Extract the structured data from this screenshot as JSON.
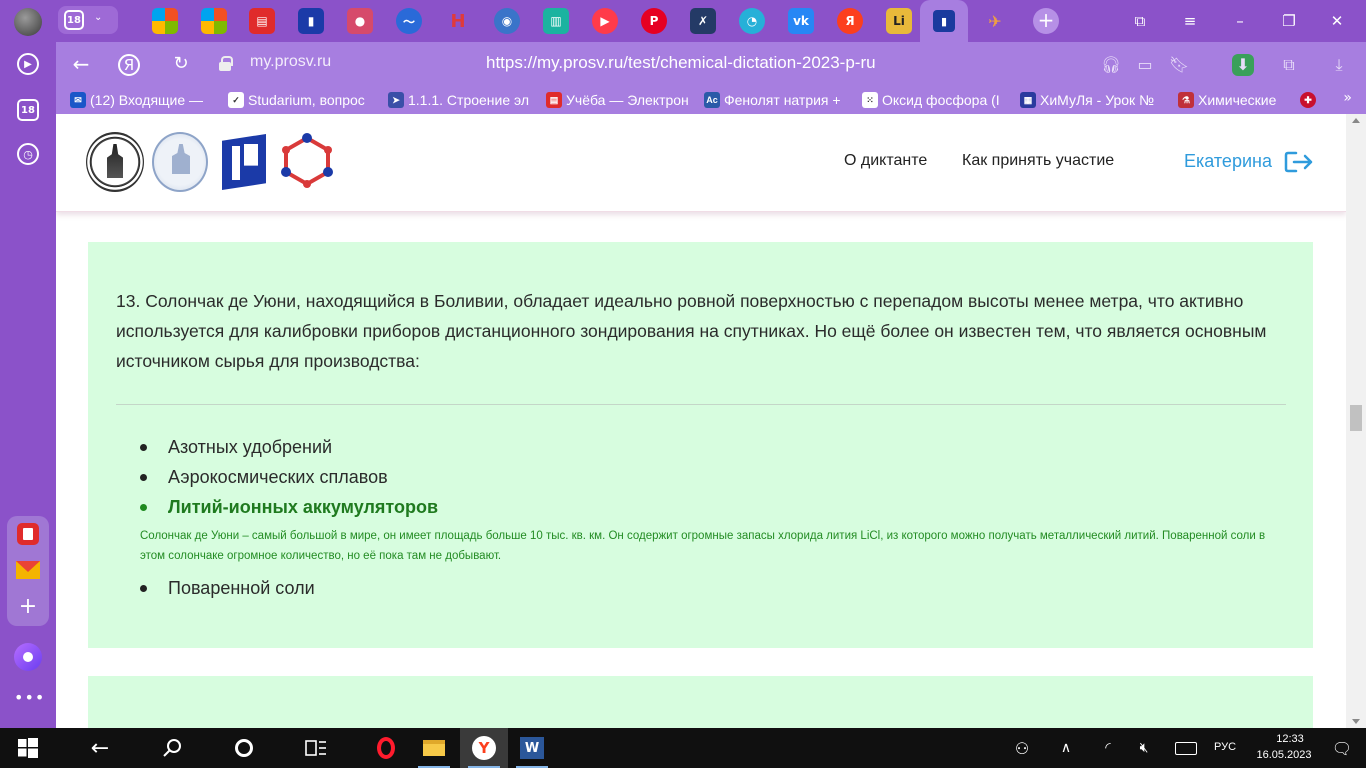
{
  "browser": {
    "tab_count": "18",
    "address": {
      "domain": "my.prosv.ru",
      "url": "https://my.prosv.ru/test/chemical-dictation-2023-p-ru"
    },
    "bookmarks": [
      "(12) Входящие — ",
      "Studarium, вопрос",
      "1.1.1. Строение эл",
      "Учёба — Электрон",
      "Фенолят натрия +",
      "Оксид фосфора (I",
      "ХиМуЛя - Урок №",
      "Химические"
    ],
    "sidebar_badge": "18"
  },
  "site": {
    "nav": [
      "О диктанте",
      "Как принять участие"
    ],
    "user_name": "Екатерина"
  },
  "question": {
    "text": "13. Солончак де Уюни, находящийся в Боливии, обладает идеально ровной поверхностью с перепадом высоты менее метра, что активно используется для калибровки приборов дистанционного зондирования на спутниках. Но ещё более он известен тем, что является основным источником сырья для производства:",
    "answers": [
      {
        "text": "Азотных удобрений",
        "correct": false
      },
      {
        "text": "Аэрокосмических сплавов",
        "correct": false
      },
      {
        "text": "Литий-ионных аккумуляторов",
        "correct": true
      },
      {
        "text": "Поваренной соли",
        "correct": false
      }
    ],
    "explanation": "Солончак де Уюни – самый большой в мире, он имеет площадь больше 10 тыс. кв. км. Он содержит огромные запасы хлорида лития LiCl, из которого можно получать металлический литий. Поваренной соли в этом солончаке огромное количество, но её пока там не добывают."
  },
  "taskbar": {
    "lang": "РУС",
    "time": "12:33",
    "date": "16.05.2023"
  },
  "colors": {
    "browser_accent": "#8b52c9",
    "card_bg": "#d7fddf",
    "correct": "#1f7a1f",
    "user_link": "#2f9bdc"
  }
}
